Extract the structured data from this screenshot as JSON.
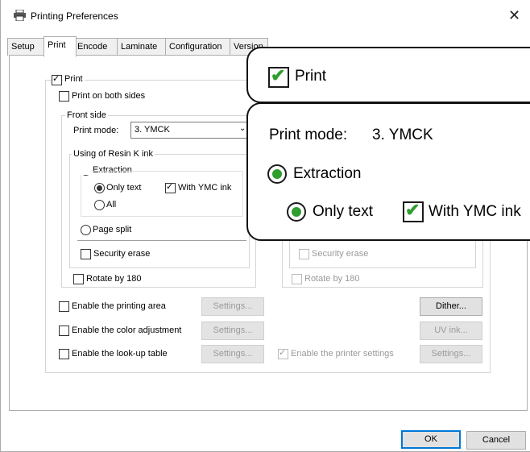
{
  "window": {
    "title": "Printing Preferences",
    "close_glyph": "✕"
  },
  "tabs": [
    "Setup",
    "Print",
    "Encode",
    "Laminate",
    "Configuration",
    "Version"
  ],
  "active_tab": "Print",
  "print_section": {
    "print_label": "Print",
    "print_checked": true,
    "both_sides_label": "Print on both sides",
    "both_sides_checked": false,
    "front_side": {
      "legend": "Front side",
      "print_mode_label": "Print mode:",
      "print_mode_value": "3. YMCK",
      "resin": {
        "legend": "Using of Resin K ink",
        "extraction_label": "Extraction",
        "only_text_label": "Only text",
        "with_ymc_label": "With YMC ink",
        "all_label": "All",
        "page_split_label": "Page split"
      },
      "security_erase_label": "Security erase",
      "rotate_label": "Rotate by 180"
    },
    "back_side": {
      "security_erase_label": "Security erase",
      "rotate_label": "Rotate by 180"
    }
  },
  "options": {
    "printing_area_label": "Enable the printing area",
    "color_adjustment_label": "Enable the color adjustment",
    "lookup_table_label": "Enable the look-up table",
    "printer_settings_label": "Enable the printer settings",
    "settings_button": "Settings...",
    "dither_button": "Dither...",
    "uv_ink_button": "UV ink..."
  },
  "footer": {
    "ok_button": "OK",
    "cancel_button": "Cancel"
  },
  "callouts": {
    "print_label": "Print",
    "print_mode_label": "Print mode:",
    "print_mode_value": "3. YMCK",
    "extraction_label": "Extraction",
    "only_text_label": "Only text",
    "with_ymc_label": "With YMC ink"
  },
  "colors": {
    "accent_green": "#2e9e2e",
    "default_button_border": "#0078d7"
  }
}
